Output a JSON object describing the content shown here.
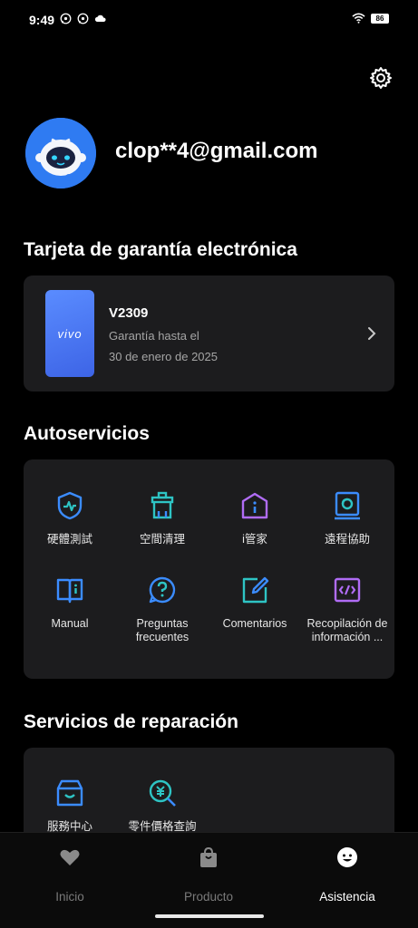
{
  "status": {
    "time": "9:49",
    "battery": "86"
  },
  "profile": {
    "email": "clop**4@gmail.com"
  },
  "warranty": {
    "title": "Tarjeta de garantía electrónica",
    "brand": "vivo",
    "model": "V2309",
    "line1": "Garantía hasta el",
    "line2": "30 de enero de 2025"
  },
  "self_service": {
    "title": "Autoservicios",
    "items": [
      {
        "label": "硬體測試",
        "icon": "hardware-test-icon"
      },
      {
        "label": "空間清理",
        "icon": "space-cleanup-icon"
      },
      {
        "label": "i管家",
        "icon": "i-manager-icon"
      },
      {
        "label": "遠程協助",
        "icon": "remote-assist-icon"
      },
      {
        "label": "Manual",
        "icon": "manual-icon"
      },
      {
        "label": "Preguntas frecuentes",
        "icon": "faq-icon"
      },
      {
        "label": "Comentarios",
        "icon": "feedback-icon"
      },
      {
        "label": "Recopilación de información ...",
        "icon": "log-collect-icon"
      }
    ]
  },
  "repair": {
    "title": "Servicios de reparación",
    "items": [
      {
        "label": "服務中心",
        "icon": "service-center-icon"
      },
      {
        "label": "零件價格查詢",
        "icon": "parts-price-icon"
      }
    ]
  },
  "tabs": [
    {
      "label": "Inicio",
      "icon": "heart-icon"
    },
    {
      "label": "Producto",
      "icon": "shopping-bag-icon"
    },
    {
      "label": "Asistencia",
      "icon": "smile-icon",
      "active": true
    }
  ],
  "colors": {
    "accent_blue": "#3b8cff",
    "accent_teal": "#2ec4c4",
    "accent_purple": "#b06cf5"
  }
}
